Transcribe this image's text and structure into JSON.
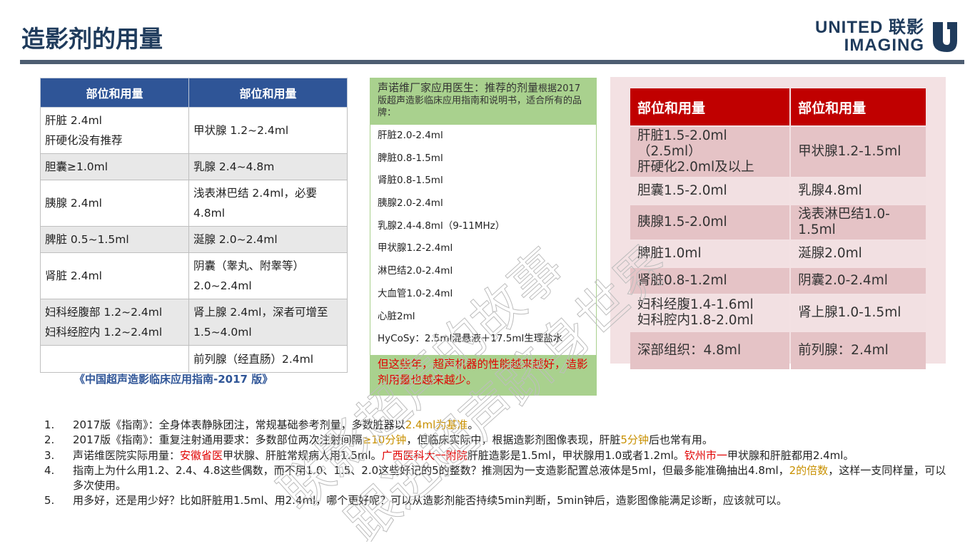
{
  "header": {
    "title": "造影剂的用量",
    "logo_line1": "UNITED 联影",
    "logo_line2": "IMAGING"
  },
  "left_table": {
    "headers": [
      "部位和用量",
      "部位和用量"
    ],
    "rows": [
      [
        "肝脏 2.4ml\n肝硬化没有推荐",
        "甲状腺 1.2~2.4ml"
      ],
      [
        "胆囊≥1.0ml",
        "乳腺 2.4~4.8m"
      ],
      [
        "胰腺 2.4ml",
        "浅表淋巴结 2.4ml，必要\n4.8ml"
      ],
      [
        "脾脏 0.5~1.5ml",
        "涎腺 2.0~2.4ml"
      ],
      [
        "肾脏 2.4ml",
        "阴囊（睾丸、附睾等）\n2.0~2.4ml"
      ],
      [
        "妇科经腹部 1.2~2.4ml\n妇科经腔内 1.2~2.4ml",
        "肾上腺 2.4ml，深者可增至\n1.5~4.0ml"
      ],
      [
        "",
        "前列腺（经直肠）2.4ml"
      ]
    ],
    "citation": "《中国超声造影临床应用指南-2017 版》"
  },
  "middle_box": {
    "head_a": "声诺维厂家应用医生：推荐的剂量",
    "head_b": "根据2017版超声造影临床应用指南和说明书，适合所有的品牌：",
    "items": [
      "肝脏2.0-2.4ml",
      "脾脏0.8-1.5ml",
      "肾脏0.8-1.5ml",
      "胰腺2.0-2.4ml",
      "乳腺2.4-4.8ml（9-11MHz）",
      "甲状腺1.2-2.4ml",
      "淋巴结2.0-2.4ml",
      "大血管1.0-2.4ml",
      "心脏2ml",
      "HyCoSy：2.5ml混悬液＋17.5ml生理盐水"
    ],
    "footer": "但这些年，超声机器的性能越来越好，造影剂用量也越来越少。"
  },
  "right_table": {
    "headers": [
      "部位和用量",
      "部位和用量"
    ],
    "rows": [
      [
        "肝脏1.5-2.0ml（2.5ml）\n肝硬化2.0ml及以上",
        "甲状腺1.2-1.5ml"
      ],
      [
        "胆囊1.5-2.0ml",
        "乳腺4.8ml"
      ],
      [
        "胰腺1.5-2.0ml",
        "浅表淋巴结1.0-1.5ml"
      ],
      [
        "脾脏1.0ml",
        "涎腺2.0ml"
      ],
      [
        "肾脏0.8-1.2ml",
        "阴囊2.0-2.4ml"
      ],
      [
        "妇科经腹1.4-1.6ml\n妇科腔内1.8-2.0ml",
        "肾上腺1.0-1.5ml"
      ],
      [
        "深部组织：4.8ml",
        "前列腺：2.4ml"
      ]
    ]
  },
  "notes": [
    {
      "num": "1.",
      "parts": [
        {
          "t": "2017版《指南》：全身体表静脉团注，常规基础参考剂量，多数脏器以",
          "c": ""
        },
        {
          "t": "2.4ml为基准",
          "c": "gold"
        },
        {
          "t": "。",
          "c": ""
        }
      ]
    },
    {
      "num": "2.",
      "parts": [
        {
          "t": "2017版《指南》：重复注射通用要求：多数部位两次注射间隔",
          "c": ""
        },
        {
          "t": "≥10分钟",
          "c": "gold"
        },
        {
          "t": "，但临床实际中，根据造影剂图像表现，肝脏",
          "c": ""
        },
        {
          "t": "5分钟",
          "c": "gold"
        },
        {
          "t": "后也常有用。",
          "c": ""
        }
      ]
    },
    {
      "num": "3.",
      "parts": [
        {
          "t": "声诺维医院实际用量：",
          "c": ""
        },
        {
          "t": "安徽省医",
          "c": "red"
        },
        {
          "t": "甲状腺、肝脏常规病人用1.5ml。",
          "c": ""
        },
        {
          "t": "广西医科大一附院",
          "c": "red"
        },
        {
          "t": "肝脏造影是1.5ml，甲状腺用1.0或者1.2ml。",
          "c": ""
        },
        {
          "t": "钦州市一",
          "c": "red"
        },
        {
          "t": "甲状腺和肝脏都用2.4ml。",
          "c": ""
        }
      ]
    },
    {
      "num": "4.",
      "parts": [
        {
          "t": "指南上为什么用1.2、2.4、4.8这些偶数，而不用1.0、1.5、2.0这些好记的5的整数？推测因为一支造影配置总液体是5ml，但最多能准确抽出4.8ml，",
          "c": ""
        },
        {
          "t": "2的倍数",
          "c": "gold"
        },
        {
          "t": "，这样一支同样量，可以多次使用。",
          "c": ""
        }
      ]
    },
    {
      "num": "5.",
      "parts": [
        {
          "t": "用多好，还是用少好？比如肝脏用1.5ml、用2.4ml，哪个更好呢？可以从造影剂能否持续5min判断，5min钟后，造影图像能满足诊断，应该就可以。",
          "c": ""
        }
      ]
    }
  ],
  "watermark": {
    "line1": "联影超声的故事",
    "line2": "跟进超声跻身世界"
  },
  "colors": {
    "title": "#1f3b5c",
    "left_header": "#2f5597",
    "right_header": "#c00000",
    "mid_green": "#a9d18e",
    "highlight_gold": "#c89000",
    "highlight_red": "#e00000"
  }
}
